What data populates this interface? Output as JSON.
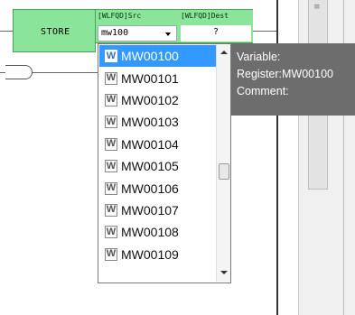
{
  "block": {
    "label": "STORE",
    "src_header": "[WLFQD]Src",
    "dest_header": "[WLFQD]Dest",
    "src_value": "mw100",
    "dest_value": "?"
  },
  "dropdown": {
    "selected_index": 0,
    "items": [
      {
        "icon": "W",
        "label": "MW00100"
      },
      {
        "icon": "W",
        "label": "MW00101"
      },
      {
        "icon": "W",
        "label": "MW00102"
      },
      {
        "icon": "W",
        "label": "MW00103"
      },
      {
        "icon": "W",
        "label": "MW00104"
      },
      {
        "icon": "W",
        "label": "MW00105"
      },
      {
        "icon": "W",
        "label": "MW00106"
      },
      {
        "icon": "W",
        "label": "MW00107"
      },
      {
        "icon": "W",
        "label": "MW00108"
      },
      {
        "icon": "W",
        "label": "MW00109"
      }
    ]
  },
  "tooltip": {
    "variable": "Variable:",
    "register": "Register:MW00100",
    "comment": "Comment:"
  },
  "colors": {
    "block_fill": "#8ae59a",
    "selection": "#3399ff",
    "tooltip_bg": "#6d6d6d"
  }
}
